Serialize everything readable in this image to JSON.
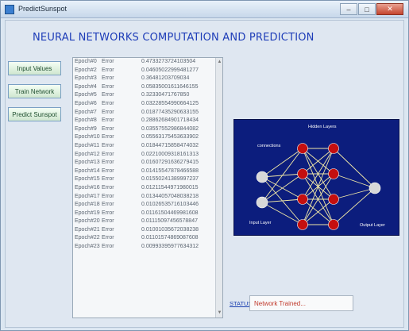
{
  "window": {
    "title": "PredictSunspot"
  },
  "heading": "NEURAL NETWORKS COMPUTATION AND PREDICTION",
  "sidebar": {
    "buttons": [
      {
        "label": "Input Values"
      },
      {
        "label": "Train Network"
      },
      {
        "label": "Predict Sunspot"
      }
    ]
  },
  "log": {
    "rows": [
      {
        "epoch": "Epoch",
        "num": "#0",
        "err": "Error",
        "value": "0.4733273724103504"
      },
      {
        "epoch": "Epoch",
        "num": "#2",
        "err": "Error",
        "value": "0.04605022999481277"
      },
      {
        "epoch": "Epoch",
        "num": "#3",
        "err": "Error",
        "value": "0.36481203709034"
      },
      {
        "epoch": "Epoch",
        "num": "#4",
        "err": "Error",
        "value": "0.05835001611646155"
      },
      {
        "epoch": "Epoch",
        "num": "#5",
        "err": "Error",
        "value": "0.32330471767850"
      },
      {
        "epoch": "Epoch",
        "num": "#6",
        "err": "Error",
        "value": "0.03228554990664125"
      },
      {
        "epoch": "Epoch",
        "num": "#7",
        "err": "Error",
        "value": "0.01877435290633155"
      },
      {
        "epoch": "Epoch",
        "num": "#8",
        "err": "Error",
        "value": "0.28862684901718434"
      },
      {
        "epoch": "Epoch",
        "num": "#9",
        "err": "Error",
        "value": "0.03557552986844082"
      },
      {
        "epoch": "Epoch",
        "num": "#10",
        "err": "Error",
        "value": "0.05563175453633902"
      },
      {
        "epoch": "Epoch",
        "num": "#11",
        "err": "Error",
        "value": "0.01844715858474032"
      },
      {
        "epoch": "Epoch",
        "num": "#12",
        "err": "Error",
        "value": "0.02210009318161313"
      },
      {
        "epoch": "Epoch",
        "num": "#13",
        "err": "Error",
        "value": "0.01607291636279415"
      },
      {
        "epoch": "Epoch",
        "num": "#14",
        "err": "Error",
        "value": "0.01415547878466588"
      },
      {
        "epoch": "Epoch",
        "num": "#15",
        "err": "Error",
        "value": "0.01550241389997237"
      },
      {
        "epoch": "Epoch",
        "num": "#16",
        "err": "Error",
        "value": "0.01211544971980015"
      },
      {
        "epoch": "Epoch",
        "num": "#17",
        "err": "Error",
        "value": "0.01344057048038218"
      },
      {
        "epoch": "Epoch",
        "num": "#18",
        "err": "Error",
        "value": "0.01026535716103446"
      },
      {
        "epoch": "Epoch",
        "num": "#19",
        "err": "Error",
        "value": "0.01161504469981608"
      },
      {
        "epoch": "Epoch",
        "num": "#20",
        "err": "Error",
        "value": "0.01115097456578847"
      },
      {
        "epoch": "Epoch",
        "num": "#21",
        "err": "Error",
        "value": "0.01001035672038238"
      },
      {
        "epoch": "Epoch",
        "num": "#22",
        "err": "Error",
        "value": "0.01101574869087608"
      },
      {
        "epoch": "Epoch",
        "num": "#23",
        "err": "Error",
        "value": "0.00993395977634312"
      }
    ]
  },
  "network_diagram": {
    "hidden_label": "Hidden Layers",
    "input_label": "Input Layer",
    "output_label": "Output Layer",
    "connections_label": "connections",
    "colors": {
      "background": "#0c1d7d",
      "hidden_node": "#c40f0f",
      "io_node": "#d8d8d8",
      "edge": "#f2e9a6"
    }
  },
  "status": {
    "button_label": "STATUS",
    "value": "Network Trained..."
  }
}
